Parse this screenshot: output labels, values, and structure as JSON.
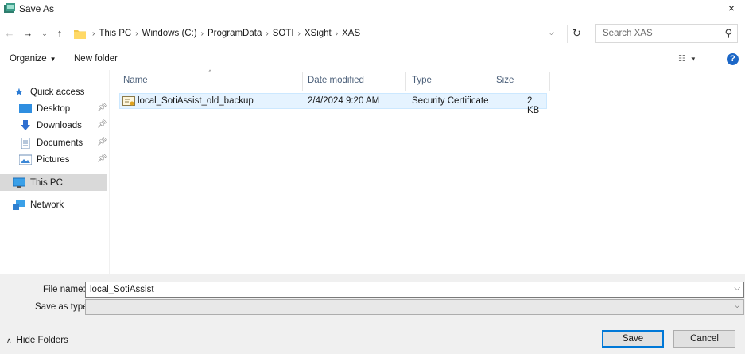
{
  "window": {
    "title": "Save As",
    "close_label": "×"
  },
  "nav": {
    "back": "←",
    "forward": "→",
    "recent": "⌄",
    "up": "↑",
    "breadcrumbs": [
      "This PC",
      "Windows (C:)",
      "ProgramData",
      "SOTI",
      "XSight",
      "XAS"
    ],
    "separator": "›",
    "refresh": "↻",
    "search_placeholder": "Search XAS"
  },
  "toolbar": {
    "organize": "Organize",
    "new_folder": "New folder",
    "help": "?"
  },
  "sidebar": {
    "items": [
      {
        "label": "Quick access",
        "icon": "star-icon"
      },
      {
        "label": "Desktop",
        "icon": "desktop-icon",
        "pinned": true
      },
      {
        "label": "Downloads",
        "icon": "downloads-icon",
        "pinned": true
      },
      {
        "label": "Documents",
        "icon": "documents-icon",
        "pinned": true
      },
      {
        "label": "Pictures",
        "icon": "pictures-icon",
        "pinned": true
      },
      {
        "label": "This PC",
        "icon": "computer-icon",
        "selected": true
      },
      {
        "label": "Network",
        "icon": "network-icon"
      }
    ]
  },
  "file_list": {
    "columns": [
      "Name",
      "Date modified",
      "Type",
      "Size"
    ],
    "rows": [
      {
        "name": "local_SotiAssist_old_backup",
        "date": "2/4/2024 9:20 AM",
        "type": "Security Certificate",
        "size": "2 KB"
      }
    ]
  },
  "form": {
    "file_name_label": "File name:",
    "file_name_value": "local_SotiAssist",
    "save_type_label": "Save as type:",
    "save_type_value": ""
  },
  "footer": {
    "hide_folders": "Hide Folders",
    "save": "Save",
    "cancel": "Cancel"
  },
  "colors": {
    "accent": "#0078d7",
    "selection": "#e5f3ff",
    "help": "#1c67c7"
  }
}
